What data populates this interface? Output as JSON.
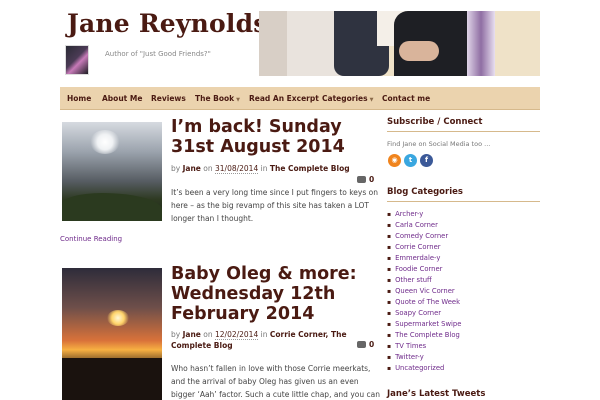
{
  "header": {
    "site_title": "Jane Reynolds",
    "tagline": "Author of \"Just Good Friends?\""
  },
  "nav": {
    "items": [
      {
        "label": "Home",
        "has_dropdown": false
      },
      {
        "label": "About Me",
        "has_dropdown": false
      },
      {
        "label": "Reviews",
        "has_dropdown": false
      },
      {
        "label": "The Book",
        "has_dropdown": true
      },
      {
        "label": "Read An Excerpt",
        "has_dropdown": false
      },
      {
        "label": "Categories",
        "has_dropdown": true
      },
      {
        "label": "Contact me",
        "has_dropdown": false
      }
    ]
  },
  "posts": [
    {
      "title": "I’m back! Sunday 31st August 2014",
      "by": "by",
      "author": "Jane",
      "on": "on",
      "date": "31/08/2014",
      "in": "in",
      "categories": "The Complete Blog",
      "comments": "0",
      "excerpt": "It’s been a very long time since I put fingers to keys on here – as the big revamp of this site has taken a LOT longer than I thought.",
      "continue_label": "Continue Reading"
    },
    {
      "title": "Baby Oleg & more: Wednesday 12th February 2014",
      "by": "by",
      "author": "Jane",
      "on": "on",
      "date": "12/02/2014",
      "in": "in",
      "categories": "Corrie Corner,  The Complete Blog",
      "comments": "0",
      "excerpt": "Who hasn’t fallen in love with those Corrie meerkats, and the arrival of baby Oleg has given us an even bigger ‘Aah’ factor. Such a cute little chap, and you can exclusively see the new"
    }
  ],
  "sidebar": {
    "subscribe_title": "Subscribe / Connect",
    "subscribe_text": "Find Jane on Social Media too ...",
    "social": [
      {
        "icon": "rss-icon",
        "glyph": "◉",
        "color": "#f0841d"
      },
      {
        "icon": "twitter-icon",
        "glyph": "t",
        "color": "#3aa7e0"
      },
      {
        "icon": "facebook-icon",
        "glyph": "f",
        "color": "#3b5998"
      }
    ],
    "categories_title": "Blog Categories",
    "categories": [
      "Archer-y",
      "Carla Corner",
      "Comedy Corner",
      "Corrie Corner",
      "Emmerdale-y",
      "Foodie Corner",
      "Other stuff",
      "Queen Vic Corner",
      "Quote of The Week",
      "Soapy Corner",
      "Supermarket Swipe",
      "The Complete Blog",
      "TV Times",
      "Twitter-y",
      "Uncategorized"
    ],
    "tweets_title": "Jane’s Latest Tweets"
  },
  "colors": {
    "accent": "#4a1a12",
    "nav_bg": "#ebd3ae",
    "link": "#6e2a8a"
  }
}
